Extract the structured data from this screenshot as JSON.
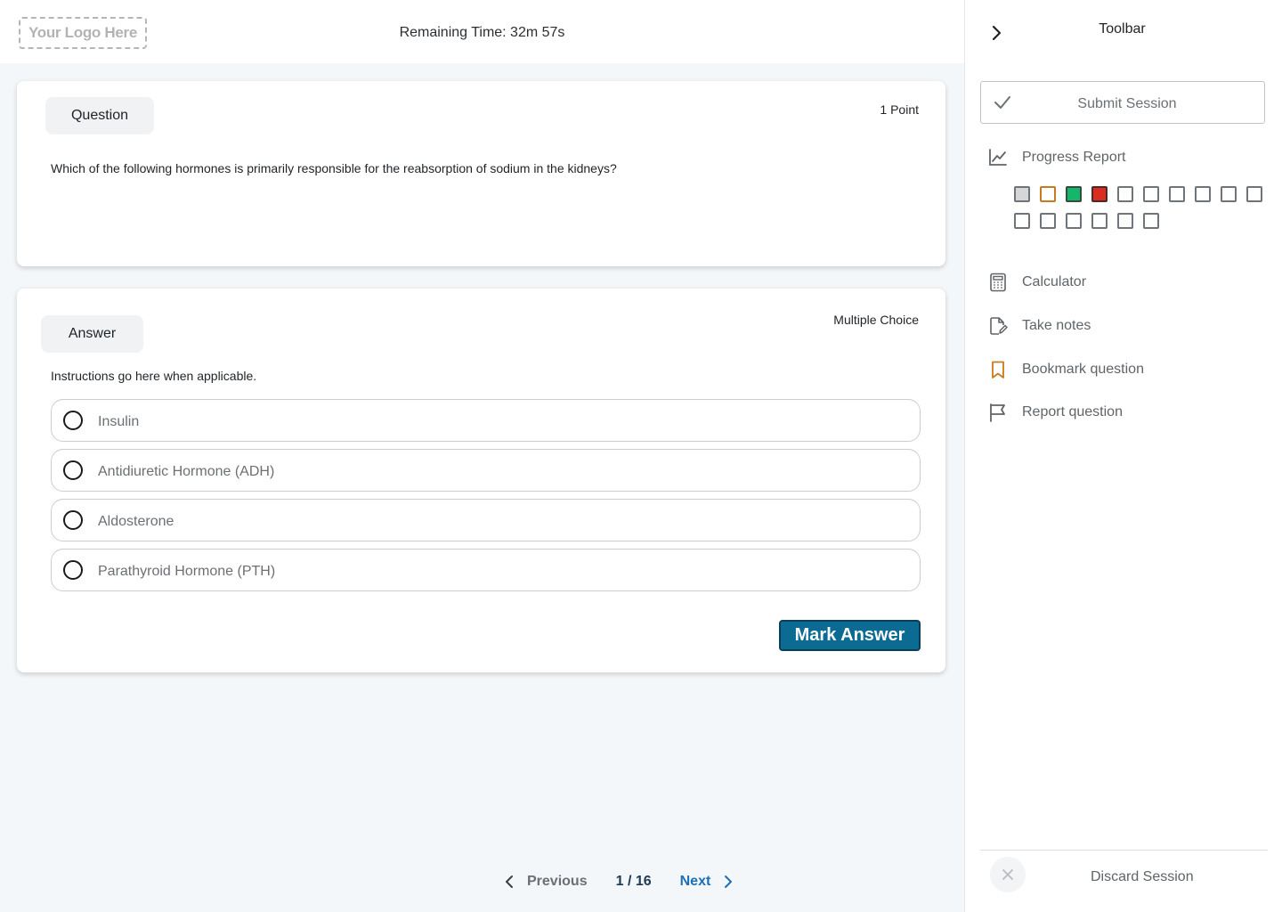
{
  "header": {
    "logo_text": "Your Logo Here",
    "timer": "Remaining Time: 32m 57s"
  },
  "question": {
    "chip_label": "Question",
    "points": "1 Point",
    "text": "Which of the following hormones is primarily responsible for the reabsorption of sodium in the kidneys?"
  },
  "answer": {
    "chip_label": "Answer",
    "type": "Multiple Choice",
    "instructions": "Instructions go here when applicable.",
    "options": [
      "Insulin",
      "Antidiuretic Hormone (ADH)",
      "Aldosterone",
      "Parathyroid Hormone (PTH)"
    ],
    "mark_label": "Mark Answer"
  },
  "pager": {
    "previous_label": "Previous",
    "count": "1 / 16",
    "next_label": "Next"
  },
  "sidebar": {
    "title": "Toolbar",
    "submit_label": "Submit Session",
    "progress_label": "Progress Report",
    "progress_states": [
      "viewed",
      "bookmarked",
      "correct",
      "incorrect",
      "unanswered",
      "unanswered",
      "unanswered",
      "unanswered",
      "unanswered",
      "unanswered",
      "unanswered",
      "unanswered",
      "unanswered",
      "unanswered",
      "unanswered",
      "unanswered"
    ],
    "tools": {
      "calculator": "Calculator",
      "notes": "Take notes",
      "bookmark": "Bookmark question",
      "report": "Report question"
    },
    "discard_label": "Discard Session"
  },
  "colors": {
    "accent": "#0c6b93",
    "link": "#1a6fb8",
    "bookmark": "#c87a1e",
    "state_viewed": "#d4d6d8",
    "state_bookmarked": "#c87a1e",
    "state_correct": "#12b76a",
    "state_incorrect": "#d92d20"
  },
  "icons": {
    "collapse": "chevron-right-icon",
    "submit": "check-icon",
    "progress": "line-chart-icon",
    "calculator": "calculator-icon",
    "notes": "note-edit-icon",
    "bookmark": "bookmark-icon",
    "report": "flag-icon",
    "discard": "close-icon",
    "previous": "chevron-left-icon",
    "next": "chevron-right-icon"
  }
}
